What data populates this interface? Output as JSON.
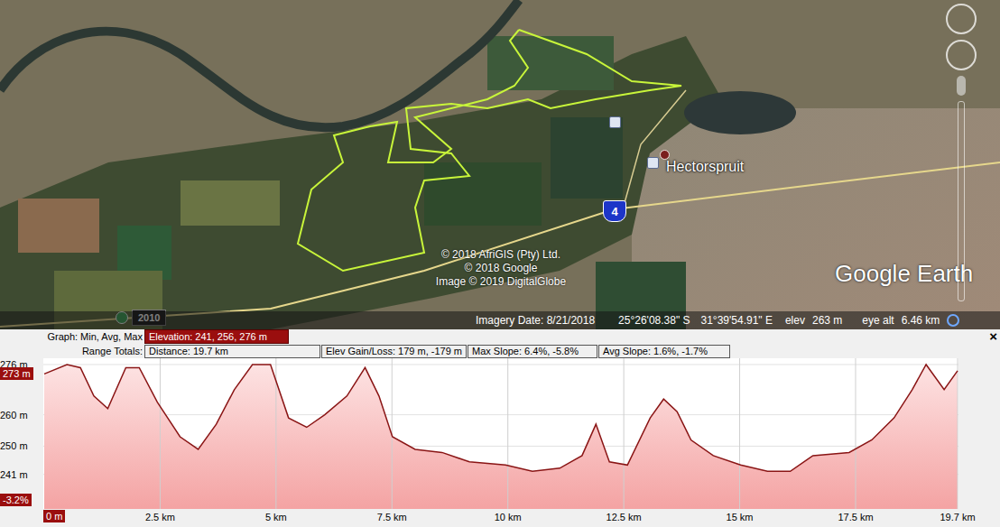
{
  "map": {
    "place_label": "Hectorspruit",
    "route_shield": "4",
    "copyright": [
      "© 2018 AfriGIS (Pty) Ltd.",
      "© 2018 Google",
      "Image © 2019 DigitalGlobe"
    ],
    "logo": "Google Earth",
    "history_button": "2010",
    "status_bar": {
      "imagery_date": "Imagery Date: 8/21/2018",
      "latitude": "25°26'08.38\" S",
      "longitude": "31°39'54.91\" E",
      "elev_label": "elev",
      "elev": "263 m",
      "eye_alt_label": "eye alt",
      "eye_alt": "6.46 km"
    }
  },
  "graph_row": {
    "label": "Graph:  Min, Avg, Max",
    "value": "Elevation: 241, 256, 276 m"
  },
  "range_row": {
    "label": "Range Totals:",
    "cells": [
      "Distance: 19.7 km",
      "Elev Gain/Loss: 179 m, -179 m",
      "Max Slope: 6.4%, -5.8%",
      "Avg Slope: 1.6%, -1.7%"
    ]
  },
  "close": "×",
  "chart": {
    "y_ticks": [
      {
        "label": "276 m",
        "value": 276
      },
      {
        "label": "260 m",
        "value": 260
      },
      {
        "label": "250 m",
        "value": 250
      },
      {
        "label": "241 m",
        "value": 241
      }
    ],
    "x_ticks": [
      {
        "label": "2.5 km",
        "value": 2.5
      },
      {
        "label": "5 km",
        "value": 5
      },
      {
        "label": "7.5 km",
        "value": 7.5
      },
      {
        "label": "10 km",
        "value": 10
      },
      {
        "label": "12.5 km",
        "value": 12.5
      },
      {
        "label": "15 km",
        "value": 15
      },
      {
        "label": "17.5 km",
        "value": 17.5
      },
      {
        "label": "19.7 km",
        "value": 19.7
      }
    ],
    "cursor": {
      "elevation": "273 m",
      "slope": "-3.2%",
      "distance": "0 m"
    },
    "distances_km": [
      0,
      0.49,
      0.78,
      1.07,
      1.37,
      1.76,
      2.05,
      2.44,
      2.93,
      3.32,
      3.71,
      4.1,
      4.49,
      4.88,
      5.27,
      5.66,
      6.05,
      6.53,
      6.92,
      7.22,
      7.51,
      8.0,
      8.58,
      9.17,
      9.95,
      10.53,
      11.12,
      11.6,
      11.9,
      12.19,
      12.58,
      13.07,
      13.36,
      13.65,
      13.95,
      14.43,
      15.02,
      15.6,
      16.09,
      16.58,
      17.36,
      17.85,
      18.33,
      18.72,
      19.02,
      19.41,
      19.7
    ],
    "elevations_m": [
      273,
      276,
      275,
      266,
      262,
      275,
      275,
      264,
      253,
      249,
      257,
      268,
      276,
      276,
      259,
      256,
      260,
      266,
      275,
      266,
      253,
      249,
      248,
      245,
      244,
      242,
      243,
      247,
      257,
      245,
      244,
      259,
      265,
      261,
      252,
      247,
      244,
      242,
      242,
      247,
      248,
      252,
      259,
      268,
      276,
      268,
      274
    ]
  }
}
